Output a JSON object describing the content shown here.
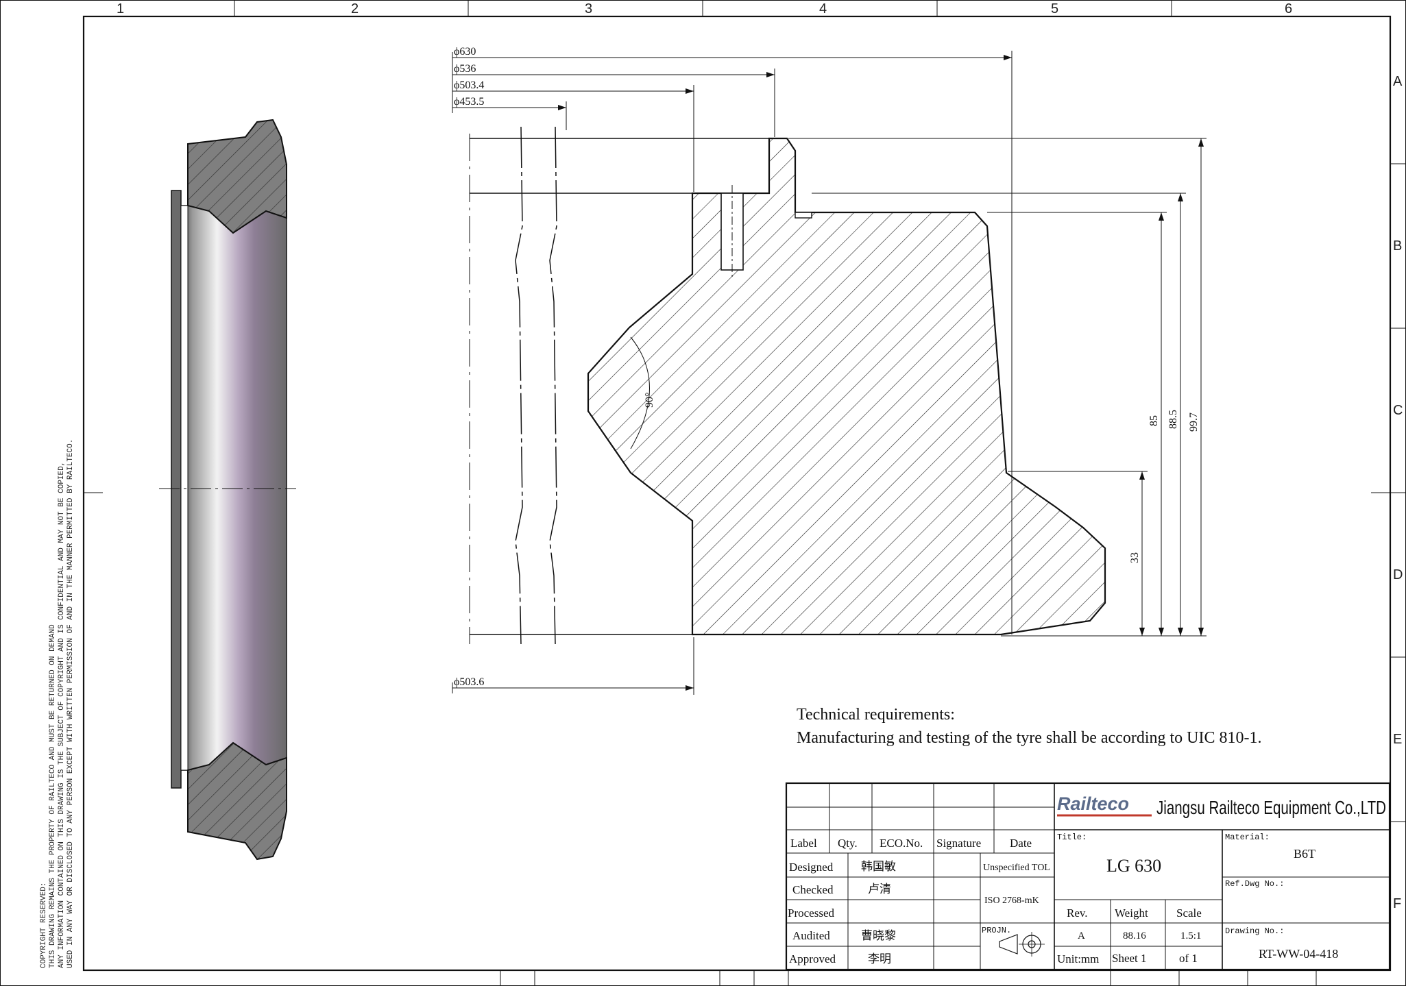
{
  "zones": {
    "columns": [
      "1",
      "2",
      "3",
      "4",
      "5",
      "6"
    ],
    "rows": [
      "A",
      "B",
      "C",
      "D",
      "E",
      "F"
    ]
  },
  "copyright": [
    "COPYRIGHT RESERVED:",
    "THIS DRAWING REMAINS THE PROPERTY OF RAILTECO AND MUST BE RETURNED ON DEMAND",
    "ANY INFORMATION CONTAINED ON THIS DRAWING IS THE SUBJECT OF COPYRIGHT AND IS CONFIDENTIAL AND MAY NOT BE COPIED,",
    "USED IN ANY WAY OR DISCLOSED TO ANY PERSON EXCEPT WITH WRITTEN PERMISSION OF AND IN THE MANNER PERMITTED BY RAILTECO."
  ],
  "dimensions": {
    "d630": "ϕ630",
    "d536": "ϕ536",
    "d503_4": "ϕ503.4",
    "d453_5": "ϕ453.5",
    "d503_6": "ϕ503.6",
    "angle": "90°",
    "h85": "85",
    "h88_5": "88.5",
    "h99_7": "99.7",
    "h33": "33"
  },
  "technical": {
    "heading": "Technical requirements:",
    "text": "Manufacturing and testing of the tyre shall be according to UIC 810-1."
  },
  "title_block": {
    "logo": "Railteco",
    "company": "Jiangsu Railteco Equipment Co.,LTD",
    "headers": {
      "label": "Label",
      "qty": "Qty.",
      "eco": "ECO.No.",
      "signature": "Signature",
      "date": "Date"
    },
    "roles": {
      "designed": "Designed",
      "checked": "Checked",
      "processed": "Processed",
      "audited": "Audited",
      "approved": "Approved"
    },
    "names": {
      "designed": "韩国敏",
      "checked": "卢清",
      "audited": "曹晓黎",
      "approved": "李明"
    },
    "tolerance_label": "Unspecified TOL",
    "tolerance_value": "ISO 2768-mK",
    "projection_label": "PROJN.",
    "title_label": "Title:",
    "title": "LG 630",
    "material_label": "Material:",
    "material": "B6T",
    "ref_label": "Ref.Dwg No.:",
    "rev_label": "Rev.",
    "weight_label": "Weight",
    "scale_label": "Scale",
    "rev": "A",
    "weight": "88.16",
    "scale": "1.5:1",
    "unit": "Unit:mm",
    "sheet": "Sheet 1",
    "of": "of 1",
    "drawing_label": "Drawing No.:",
    "drawing_no": "RT-WW-04-418"
  },
  "colors": {
    "ink": "#111111",
    "section_fill": "#8a8a8a",
    "bore_tint": "#8e7f96"
  }
}
